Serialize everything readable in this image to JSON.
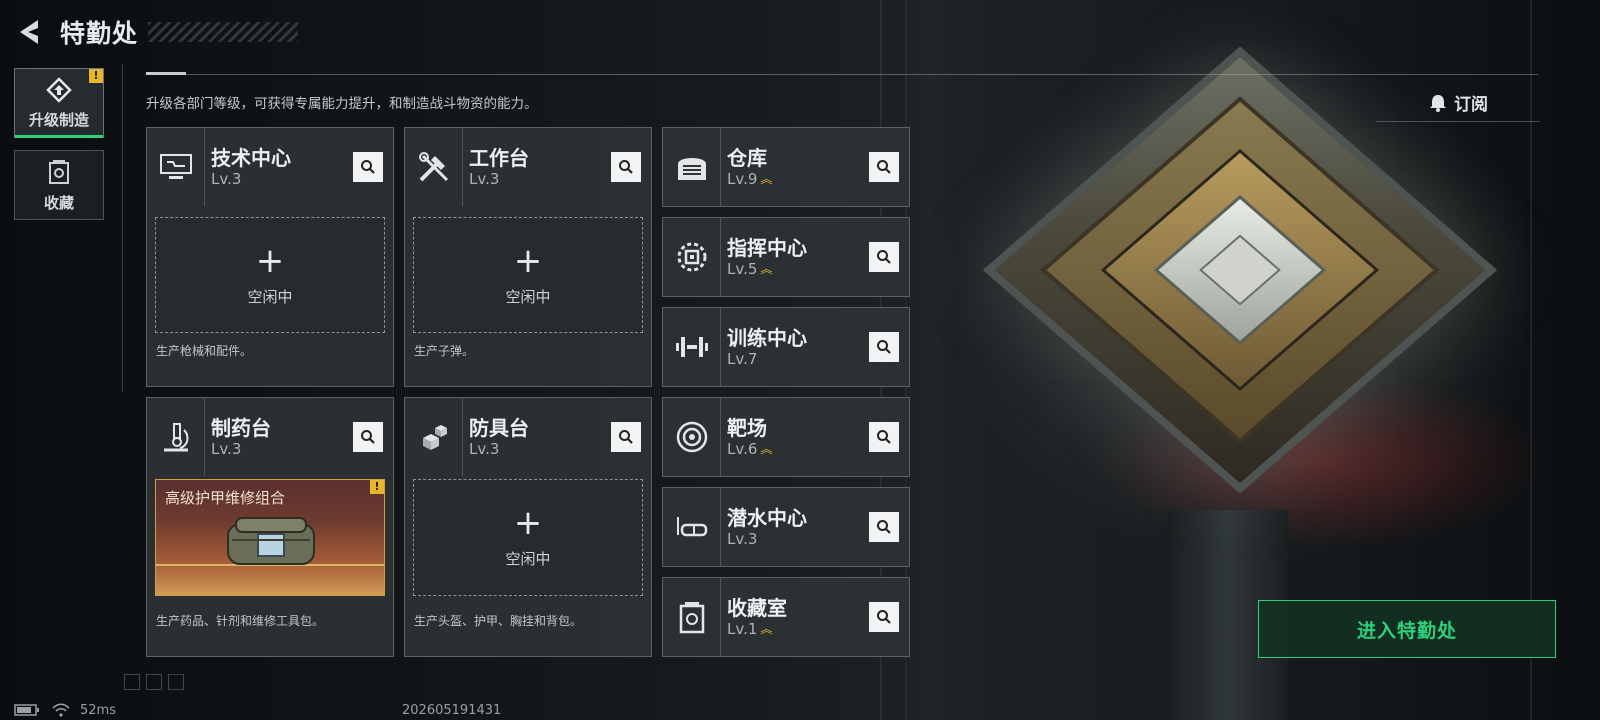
{
  "header": {
    "title": "特勤处"
  },
  "nav": {
    "tabs": [
      {
        "label": "升级制造",
        "active": true,
        "alert": "!"
      },
      {
        "label": "收藏",
        "active": false
      }
    ]
  },
  "description": "升级各部门等级，可获得专属能力提升，和制造战斗物资的能力。",
  "subscribe": {
    "label": "订阅"
  },
  "facilities": [
    {
      "name": "技术中心",
      "level": "Lv.3",
      "slot_status": "空闲中",
      "subtitle": "生产枪械和配件。",
      "icon": "monitor-icon",
      "upgradable": false
    },
    {
      "name": "工作台",
      "level": "Lv.3",
      "slot_status": "空闲中",
      "subtitle": "生产子弹。",
      "icon": "tools-icon",
      "upgradable": false
    },
    {
      "name": "制药台",
      "level": "Lv.3",
      "product": "高级护甲维修组合",
      "product_alert": "!",
      "subtitle": "生产药品、针剂和维修工具包。",
      "icon": "microscope-icon",
      "upgradable": false
    },
    {
      "name": "防具台",
      "level": "Lv.3",
      "slot_status": "空闲中",
      "subtitle": "生产头盔、护甲、胸挂和背包。",
      "icon": "armor-boxes-icon",
      "upgradable": false
    }
  ],
  "departments": [
    {
      "name": "仓库",
      "level": "Lv.9",
      "icon": "warehouse-icon",
      "upgradable": true
    },
    {
      "name": "指挥中心",
      "level": "Lv.5",
      "icon": "chip-icon",
      "upgradable": true
    },
    {
      "name": "训练中心",
      "level": "Lv.7",
      "icon": "dumbbell-icon",
      "upgradable": false
    },
    {
      "name": "靶场",
      "level": "Lv.6",
      "icon": "target-icon",
      "upgradable": true
    },
    {
      "name": "潜水中心",
      "level": "Lv.3",
      "icon": "diving-mask-icon",
      "upgradable": false
    },
    {
      "name": "收藏室",
      "level": "Lv.1",
      "icon": "collection-icon",
      "upgradable": true
    }
  ],
  "cta": {
    "label": "进入特勤处"
  },
  "status": {
    "ping": "52ms",
    "build": "202605191431"
  },
  "colors": {
    "accent": "#2fd07a",
    "warning": "#e7b62a",
    "level_up": "#e5b340"
  }
}
